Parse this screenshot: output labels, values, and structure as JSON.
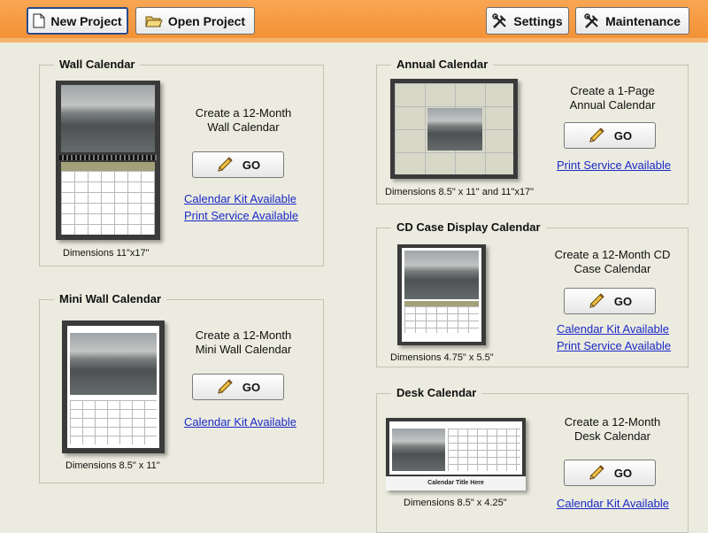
{
  "toolbar": {
    "new_project": "New Project",
    "open_project": "Open Project",
    "settings": "Settings",
    "maintenance": "Maintenance"
  },
  "go_label": "GO",
  "wall": {
    "title": "Wall Calendar",
    "description": "Create a 12-Month\nWall Calendar",
    "link1": "Calendar Kit Available",
    "link2": "Print Service Available",
    "dimensions": "Dimensions  11\"x17\""
  },
  "mini": {
    "title": "Mini Wall Calendar",
    "description": "Create a 12-Month\nMini Wall Calendar",
    "link1": "Calendar Kit Available",
    "dimensions": "Dimensions  8.5\" x 11\""
  },
  "annual": {
    "title": "Annual Calendar",
    "description": "Create a 1-Page\nAnnual Calendar",
    "link1": "Print Service Available",
    "dimensions": "Dimensions  8.5\" x 11\" and 11\"x17\""
  },
  "cd": {
    "title": "CD Case Display Calendar",
    "description": "Create a 12-Month CD\nCase Calendar",
    "link1": "Calendar Kit Available",
    "link2": "Print Service Available",
    "dimensions": "Dimensions  4.75\" x 5.5\""
  },
  "desk": {
    "title": "Desk Calendar",
    "description": "Create a 12-Month\nDesk Calendar",
    "link1": "Calendar Kit Available",
    "dimensions": "Dimensions  8.5\" x 4.25\"",
    "thumb_caption": "Calendar Title Here"
  }
}
